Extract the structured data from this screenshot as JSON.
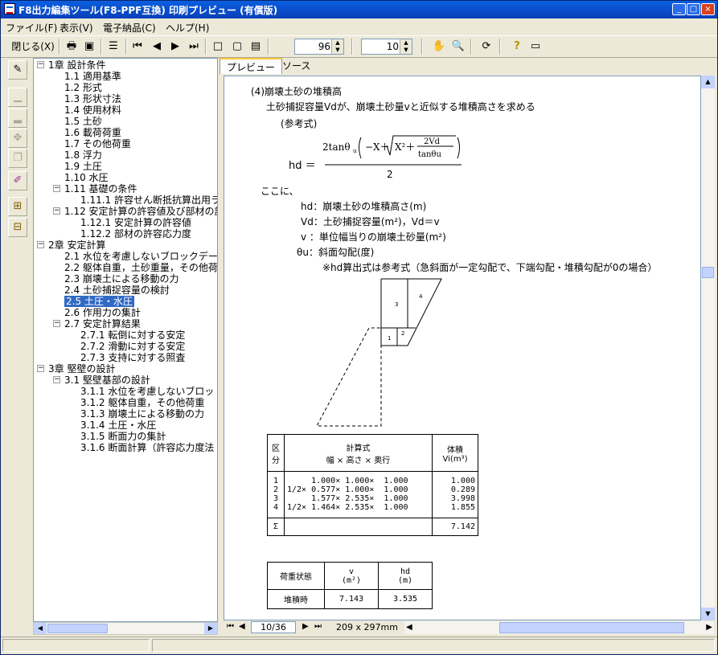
{
  "title_bar": {
    "title": "F8出力編集ツール(F8-PPF互換) 印刷プレビュー (有償版)"
  },
  "menu": [
    "ファイル(F)",
    "表示(V)",
    "電子納品(C)",
    "ヘルプ(H)"
  ],
  "toolbar": {
    "close_label": "閉じる(X)",
    "zoom_value": "96",
    "step_value": "10"
  },
  "tree": [
    {
      "label": "1章 設計条件",
      "level": 0,
      "box": "minus"
    },
    {
      "label": "1.1 適用基準",
      "level": 1
    },
    {
      "label": "1.2 形式",
      "level": 1
    },
    {
      "label": "1.3 形状寸法",
      "level": 1
    },
    {
      "label": "1.4 使用材料",
      "level": 1
    },
    {
      "label": "1.5 土砂",
      "level": 1
    },
    {
      "label": "1.6 載荷荷重",
      "level": 1
    },
    {
      "label": "1.7 その他荷重",
      "level": 1
    },
    {
      "label": "1.8 浮力",
      "level": 1
    },
    {
      "label": "1.9 土圧",
      "level": 1
    },
    {
      "label": "1.10 水圧",
      "level": 1
    },
    {
      "label": "1.11 基礎の条件",
      "level": 1,
      "box": "minus"
    },
    {
      "label": "1.11.1 許容せん断抵抗算出用ラ",
      "level": 2
    },
    {
      "label": "1.12 安定計算の許容値及び部材の許",
      "level": 1,
      "box": "minus"
    },
    {
      "label": "1.12.1 安定計算の許容値",
      "level": 2
    },
    {
      "label": "1.12.2 部材の許容応力度",
      "level": 2
    },
    {
      "label": "2章 安定計算",
      "level": 0,
      "box": "minus"
    },
    {
      "label": "2.1 水位を考慮しないブロックデー",
      "level": 1
    },
    {
      "label": "2.2 躯体自重，土砂重量，その他荷",
      "level": 1
    },
    {
      "label": "2.3 崩壊土による移動の力",
      "level": 1
    },
    {
      "label": "2.4 土砂捕捉容量の検討",
      "level": 1
    },
    {
      "label": "2.5 土圧・水圧",
      "level": 1,
      "selected": true
    },
    {
      "label": "2.6 作用力の集計",
      "level": 1
    },
    {
      "label": "2.7 安定計算結果",
      "level": 1,
      "box": "minus"
    },
    {
      "label": "2.7.1 転倒に対する安定",
      "level": 2
    },
    {
      "label": "2.7.2 滑動に対する安定",
      "level": 2
    },
    {
      "label": "2.7.3 支持に対する照査",
      "level": 2
    },
    {
      "label": "3章 堅壁の設計",
      "level": 0,
      "box": "minus"
    },
    {
      "label": "3.1 堅壁基部の設計",
      "level": 1,
      "box": "minus"
    },
    {
      "label": "3.1.1 水位を考慮しないブロッ",
      "level": 2
    },
    {
      "label": "3.1.2 躯体自重，その他荷重",
      "level": 2
    },
    {
      "label": "3.1.3 崩壊土による移動の力",
      "level": 2
    },
    {
      "label": "3.1.4 土圧・水圧",
      "level": 2
    },
    {
      "label": "3.1.5 断面力の集計",
      "level": 2
    },
    {
      "label": "3.1.6 断面計算（許容応力度法",
      "level": 2
    }
  ],
  "tabs": [
    "プレビュー",
    "ソース"
  ],
  "document": {
    "heading": "(4)崩壊土砂の堆積高",
    "intro": "土砂捕捉容量Vdが、崩壊土砂量vと近似する堆積高さを求める",
    "ref": "(参考式)",
    "formula_lhs": "hd ＝",
    "formula_num": "2tanθu(−X＋√(X²＋2Vd/tanθu))",
    "formula_den": "2",
    "where": "ここに、",
    "defs": [
      "hd：崩壊土砂の堆積高さ(m)",
      "Vd：土砂捕捉容量(m²)，Vd＝v",
      "v ：単位幅当りの崩壊土砂量(m²)",
      "θu：斜面勾配(度)",
      "※hd算出式は参考式（急斜面が一定勾配で、下端勾配・堆積勾配が0の場合）"
    ],
    "diagram_labels": [
      "3",
      "4",
      "1",
      "2"
    ],
    "calc_table": {
      "headers": [
        "区分",
        "計算式",
        "幅 × 高さ × 奥行",
        "体積",
        "Vi(m³)"
      ],
      "rows": [
        {
          "no": "1",
          "expr": "     1.000× 1.000×  1.000",
          "vol": "1.000"
        },
        {
          "no": "2",
          "expr": "1/2× 0.577× 1.000×  1.000",
          "vol": "0.289"
        },
        {
          "no": "3",
          "expr": "     1.577× 2.535×  1.000",
          "vol": "3.998"
        },
        {
          "no": "4",
          "expr": "1/2× 1.464× 2.535×  1.000",
          "vol": "1.855"
        }
      ],
      "sum_label": "Σ",
      "sum_value": "7.142"
    },
    "result_table": {
      "headers": [
        "荷重状態",
        "v",
        "(m²)",
        "hd",
        "(m)"
      ],
      "rows": [
        {
          "state": "堆積時",
          "v": "7.143",
          "hd": "3.535"
        }
      ]
    }
  },
  "bottom_nav": {
    "page": "10/36",
    "paper": "209 x 297mm"
  }
}
